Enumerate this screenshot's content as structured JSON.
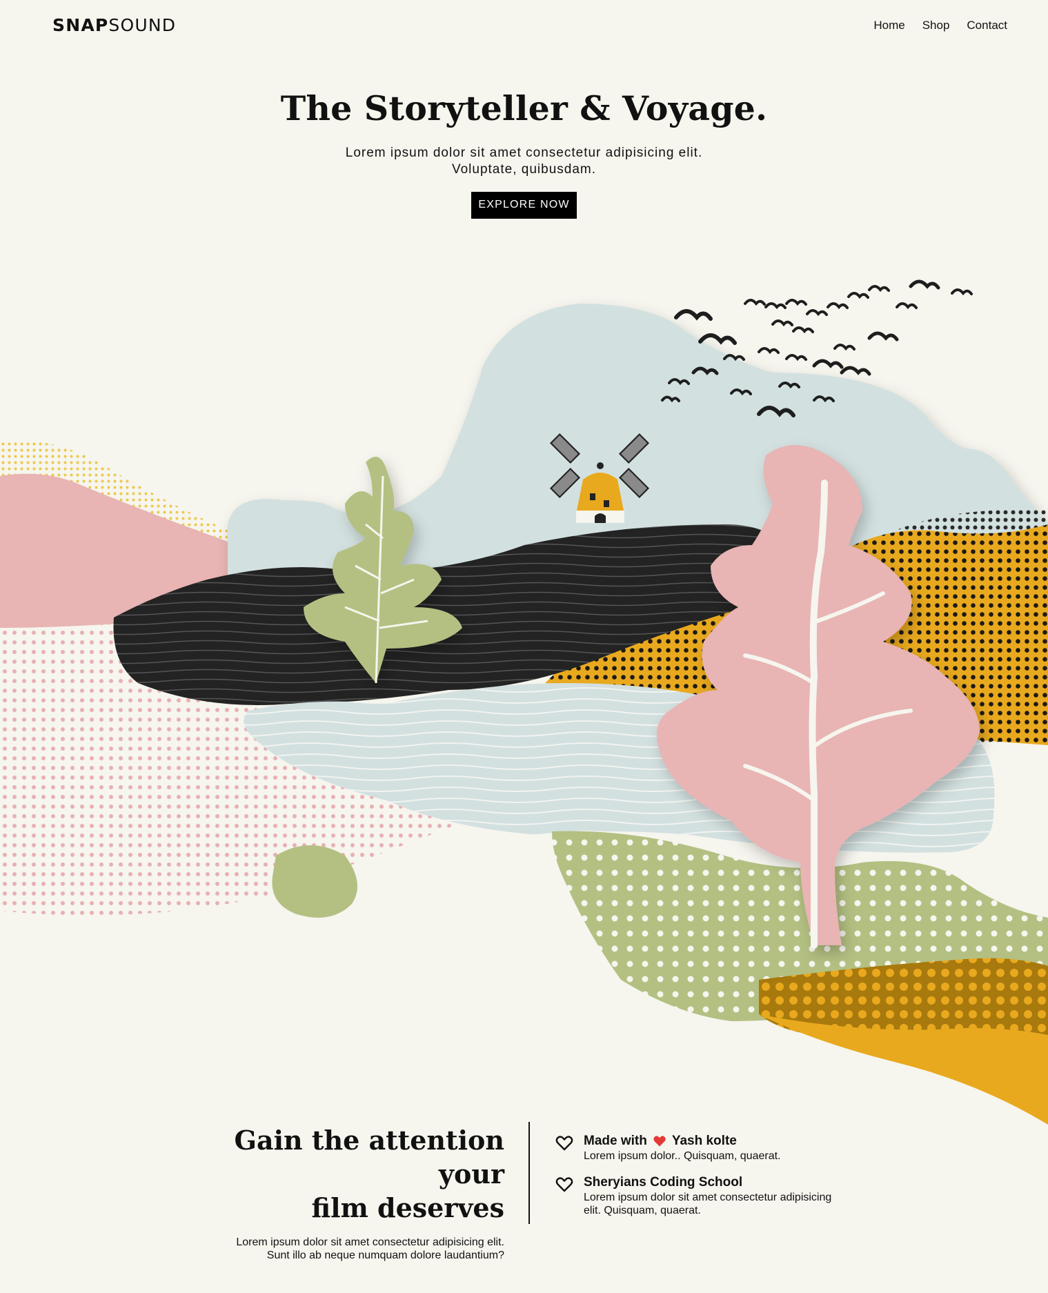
{
  "nav": {
    "logo_bold": "SNAP",
    "logo_light": "SOUND",
    "links": [
      "Home",
      "Shop",
      "Contact"
    ]
  },
  "hero": {
    "title": "The Storyteller & Voyage.",
    "subtitle_line1": "Lorem ipsum dolor sit amet consectetur adipisicing elit.",
    "subtitle_line2": "Voluptate, quibusdam.",
    "cta": "EXPLORE NOW"
  },
  "footer": {
    "heading_line1": "Gain the attention your",
    "heading_line2": "film deserves",
    "desc_line1": "Lorem ipsum dolor sit amet consectetur adipisicing elit.",
    "desc_line2": "Sunt illo ab neque numquam dolore laudantium?",
    "items": [
      {
        "title_pre": "Made with",
        "title_post": "Yash kolte",
        "desc": "Lorem ipsum dolor.. Quisquam, quaerat."
      },
      {
        "title": "Sheryians Coding School",
        "desc_line1": "Lorem ipsum dolor sit amet consectetur adipisicing",
        "desc_line2": "elit. Quisquam, quaerat."
      }
    ]
  },
  "colors": {
    "background": "#f6f5ee",
    "mustard": "#e9a91e",
    "pink": "#e8b4b4",
    "sage": "#b3c082",
    "mist": "#d3e0e0",
    "ink": "#222222",
    "heart": "#e53935"
  },
  "icons": [
    "heart-outline-icon",
    "heart-filled-icon"
  ]
}
